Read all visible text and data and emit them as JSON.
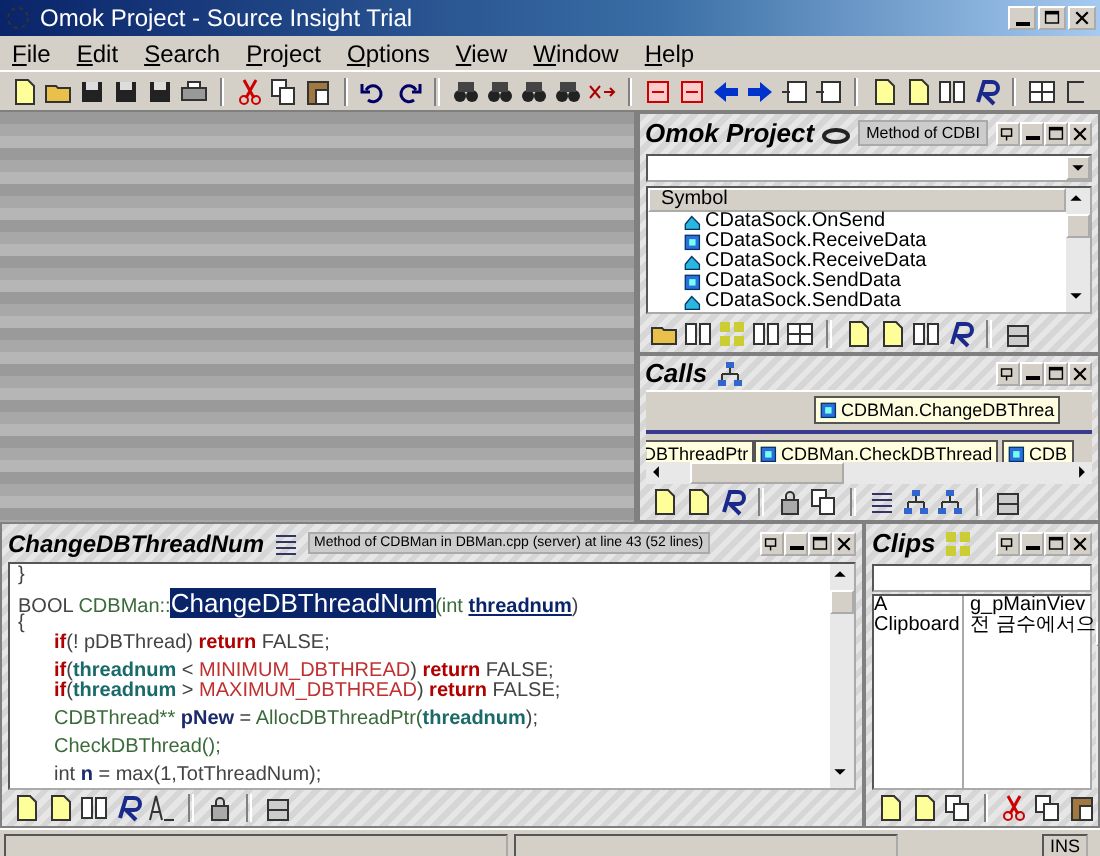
{
  "window": {
    "title": "Omok Project - Source Insight Trial"
  },
  "menu": [
    "File",
    "Edit",
    "Search",
    "Project",
    "Options",
    "View",
    "Window",
    "Help"
  ],
  "project_panel": {
    "title": "Omok Project",
    "info": "Method of CDBI",
    "column": "Symbol",
    "symbols": [
      {
        "name": "CDataSock.OnSend",
        "kind": "declaration"
      },
      {
        "name": "CDataSock.ReceiveData",
        "kind": "definition"
      },
      {
        "name": "CDataSock.ReceiveData",
        "kind": "declaration"
      },
      {
        "name": "CDataSock.SendData",
        "kind": "definition"
      },
      {
        "name": "CDataSock.SendData",
        "kind": "declaration"
      }
    ]
  },
  "calls_panel": {
    "title": "Calls",
    "nodes": [
      {
        "label": "CDBMan.ChangeDBThrea"
      },
      {
        "label": "DBThreadPtr"
      },
      {
        "label": "CDBMan.CheckDBThread"
      },
      {
        "label": "CDB"
      }
    ]
  },
  "editor_panel": {
    "title": "ChangeDBThreadNum",
    "info": "Method of CDBMan in DBMan.cpp (server) at line 43 (52 lines)",
    "lines": [
      {
        "indent": false,
        "space_before": false,
        "tokens": [
          {
            "t": "}",
            "kind": "plain"
          }
        ]
      },
      {
        "indent": false,
        "space_before": true,
        "tokens": [
          {
            "t": "BOOL ",
            "kind": "plain"
          },
          {
            "t": "CDBMan::",
            "kind": "func"
          },
          {
            "t": "ChangeDBThreadNum",
            "kind": "selected"
          },
          {
            "t": "(int ",
            "kind": "func"
          },
          {
            "t": "threadnum",
            "kind": "param"
          },
          {
            "t": ")",
            "kind": "plain"
          }
        ]
      },
      {
        "indent": false,
        "space_before": false,
        "tokens": [
          {
            "t": "{",
            "kind": "plain"
          }
        ]
      },
      {
        "indent": true,
        "space_before": false,
        "tokens": [
          {
            "t": "if",
            "kind": "keyword"
          },
          {
            "t": "(! pDBThread) ",
            "kind": "plain"
          },
          {
            "t": "return",
            "kind": "keyword"
          },
          {
            "t": " FALSE;",
            "kind": "plain"
          }
        ]
      },
      {
        "indent": true,
        "space_before": true,
        "tokens": [
          {
            "t": "if",
            "kind": "keyword"
          },
          {
            "t": "(",
            "kind": "plain"
          },
          {
            "t": "threadnum",
            "kind": "var"
          },
          {
            "t": " < ",
            "kind": "plain"
          },
          {
            "t": "MINIMUM_DBTHREAD",
            "kind": "const"
          },
          {
            "t": ") ",
            "kind": "plain"
          },
          {
            "t": "return",
            "kind": "keyword"
          },
          {
            "t": " FALSE;",
            "kind": "plain"
          }
        ]
      },
      {
        "indent": true,
        "space_before": false,
        "tokens": [
          {
            "t": "if",
            "kind": "keyword"
          },
          {
            "t": "(",
            "kind": "plain"
          },
          {
            "t": "threadnum",
            "kind": "var"
          },
          {
            "t": " > ",
            "kind": "plain"
          },
          {
            "t": "MAXIMUM_DBTHREAD",
            "kind": "const"
          },
          {
            "t": ") ",
            "kind": "plain"
          },
          {
            "t": "return",
            "kind": "keyword"
          },
          {
            "t": " FALSE;",
            "kind": "plain"
          }
        ]
      },
      {
        "indent": true,
        "space_before": true,
        "tokens": [
          {
            "t": "CDBThread** ",
            "kind": "func"
          },
          {
            "t": "pNew",
            "kind": "local"
          },
          {
            "t": " = ",
            "kind": "plain"
          },
          {
            "t": "AllocDBThreadPtr(",
            "kind": "func"
          },
          {
            "t": "threadnum",
            "kind": "var"
          },
          {
            "t": ");",
            "kind": "plain"
          }
        ]
      },
      {
        "indent": true,
        "space_before": true,
        "tokens": [
          {
            "t": "CheckDBThread();",
            "kind": "func"
          }
        ]
      },
      {
        "indent": true,
        "space_before": true,
        "tokens": [
          {
            "t": "int ",
            "kind": "plain"
          },
          {
            "t": "n",
            "kind": "local"
          },
          {
            "t": " = max(1,TotThreadNum);",
            "kind": "plain"
          }
        ]
      }
    ]
  },
  "clips_panel": {
    "title": "Clips",
    "rows": [
      {
        "name": "A",
        "text": "g_pMainViev"
      },
      {
        "name": "Clipboard",
        "text": "전 금수에서으"
      }
    ]
  },
  "status_bar": {
    "mode": "INS"
  }
}
